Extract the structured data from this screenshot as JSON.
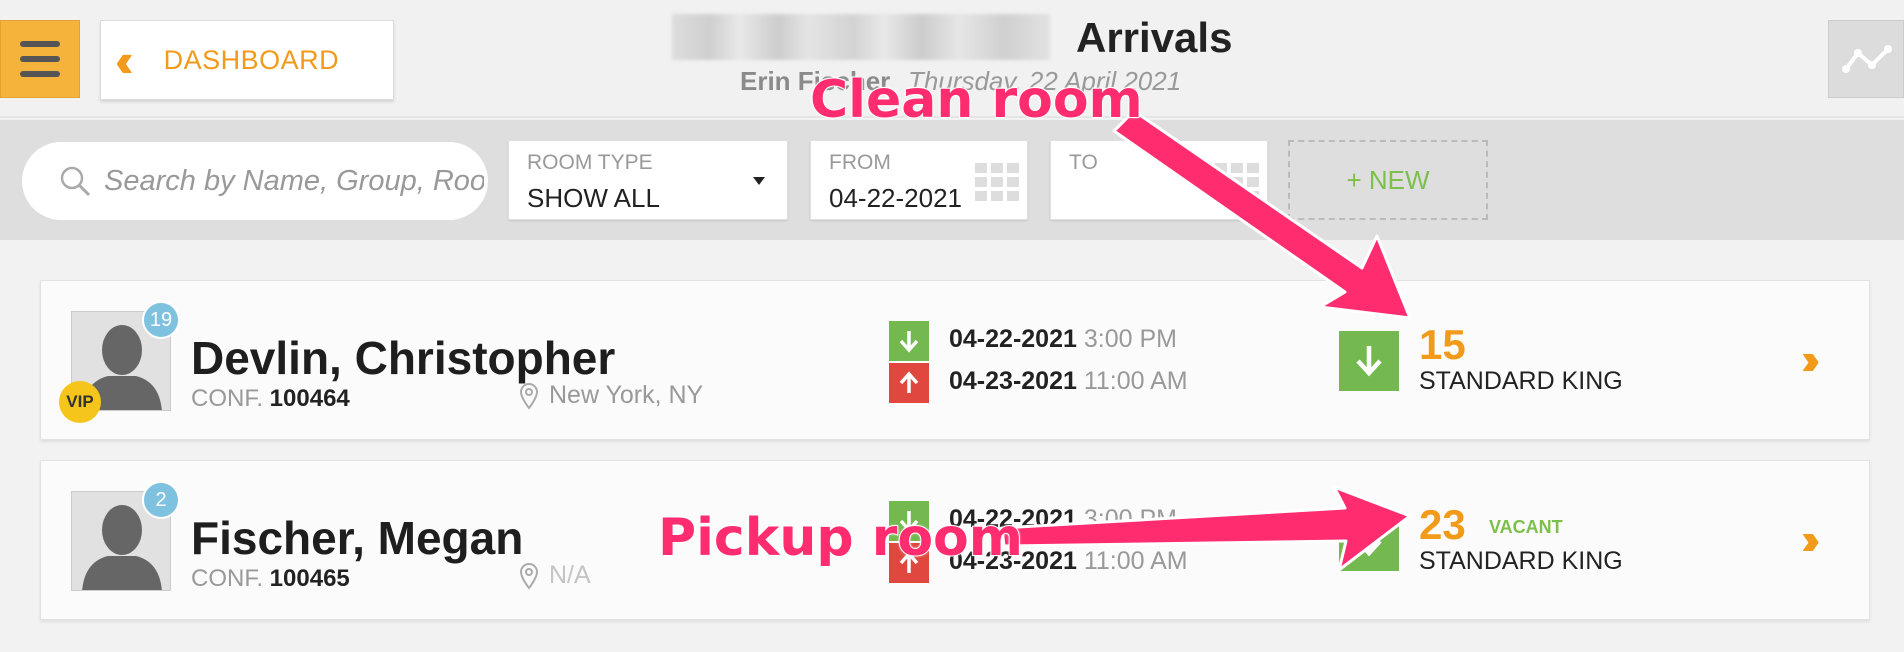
{
  "header": {
    "menu_icon": "hamburger-icon",
    "dashboard_label": "DASHBOARD",
    "title": "Arrivals",
    "user": "Erin Fischer",
    "date": "Thursday, 22 April 2021",
    "accent_color": "#f29a1a"
  },
  "filters": {
    "search_placeholder": "Search by Name, Group, Room",
    "room_type": {
      "label": "ROOM TYPE",
      "value": "SHOW ALL"
    },
    "from": {
      "label": "FROM",
      "value": "04-22-2021"
    },
    "to": {
      "label": "TO",
      "value": ""
    },
    "new_label": "+ NEW"
  },
  "guests": [
    {
      "name": "Devlin, Christopher",
      "count": "19",
      "vip": "VIP",
      "conf_label": "CONF.",
      "conf": "100464",
      "location": "New York, NY",
      "arrive_date": "04-22-2021",
      "arrive_time": "3:00 PM",
      "depart_date": "04-23-2021",
      "depart_time": "11:00 AM",
      "room_number": "15",
      "room_type": "STANDARD KING",
      "room_status": ""
    },
    {
      "name": "Fischer, Megan",
      "count": "2",
      "vip": "",
      "conf_label": "CONF.",
      "conf": "100465",
      "location": "N/A",
      "arrive_date": "04-22-2021",
      "arrive_time": "3:00 PM",
      "depart_date": "04-23-2021",
      "depart_time": "11:00 AM",
      "room_number": "23",
      "room_type": "STANDARD KING",
      "room_status": "VACANT"
    }
  ],
  "annotations": {
    "clean_room": "Clean room",
    "pickup_room": "Pickup room",
    "color": "#ff2d6f"
  }
}
